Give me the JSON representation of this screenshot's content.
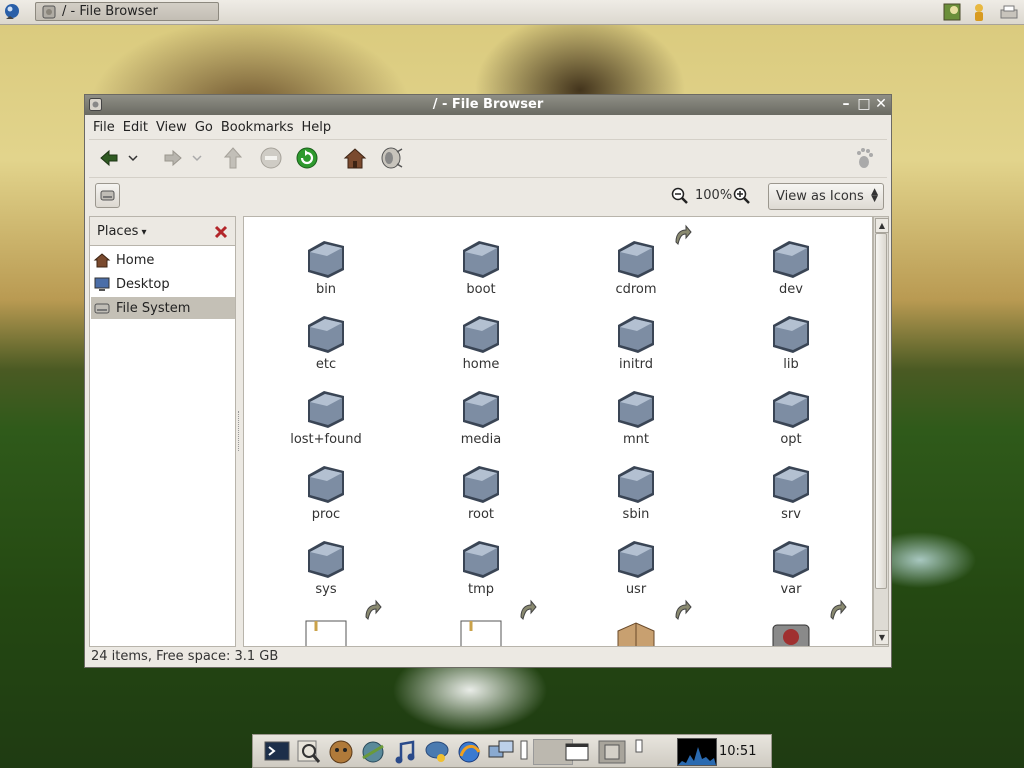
{
  "top_panel": {
    "task_button_label": "/ - File Browser"
  },
  "window": {
    "title": "/ - File Browser",
    "menus": [
      {
        "label": "File"
      },
      {
        "label": "Edit"
      },
      {
        "label": "View"
      },
      {
        "label": "Go"
      },
      {
        "label": "Bookmarks"
      },
      {
        "label": "Help"
      }
    ],
    "toolbar_icons": [
      "back-icon",
      "back-history-icon",
      "forward-icon",
      "forward-history-icon",
      "up-icon",
      "stop-icon",
      "reload-icon",
      "home-icon",
      "computer-icon"
    ],
    "zoom_level": "100%",
    "view_mode": "View as Icons",
    "sidebar": {
      "header": "Places",
      "items": [
        {
          "label": "Home",
          "icon": "home-icon"
        },
        {
          "label": "Desktop",
          "icon": "desktop-icon"
        },
        {
          "label": "File System",
          "icon": "drive-icon",
          "selected": true
        }
      ]
    },
    "files": [
      {
        "name": "bin"
      },
      {
        "name": "boot"
      },
      {
        "name": "cdrom",
        "symlink": true
      },
      {
        "name": "dev"
      },
      {
        "name": "etc"
      },
      {
        "name": "home"
      },
      {
        "name": "initrd"
      },
      {
        "name": "lib"
      },
      {
        "name": "lost+found"
      },
      {
        "name": "media"
      },
      {
        "name": "mnt"
      },
      {
        "name": "opt"
      },
      {
        "name": "proc"
      },
      {
        "name": "root"
      },
      {
        "name": "sbin"
      },
      {
        "name": "srv"
      },
      {
        "name": "sys"
      },
      {
        "name": "tmp"
      },
      {
        "name": "usr"
      },
      {
        "name": "var"
      }
    ],
    "status": "24 items, Free space: 3.1 GB"
  },
  "bottom_panel": {
    "clock": "10:51"
  },
  "colors": {
    "titlebar": "#7a7a72",
    "selection": "#c4c0b6",
    "folder": "#6f7f95"
  }
}
